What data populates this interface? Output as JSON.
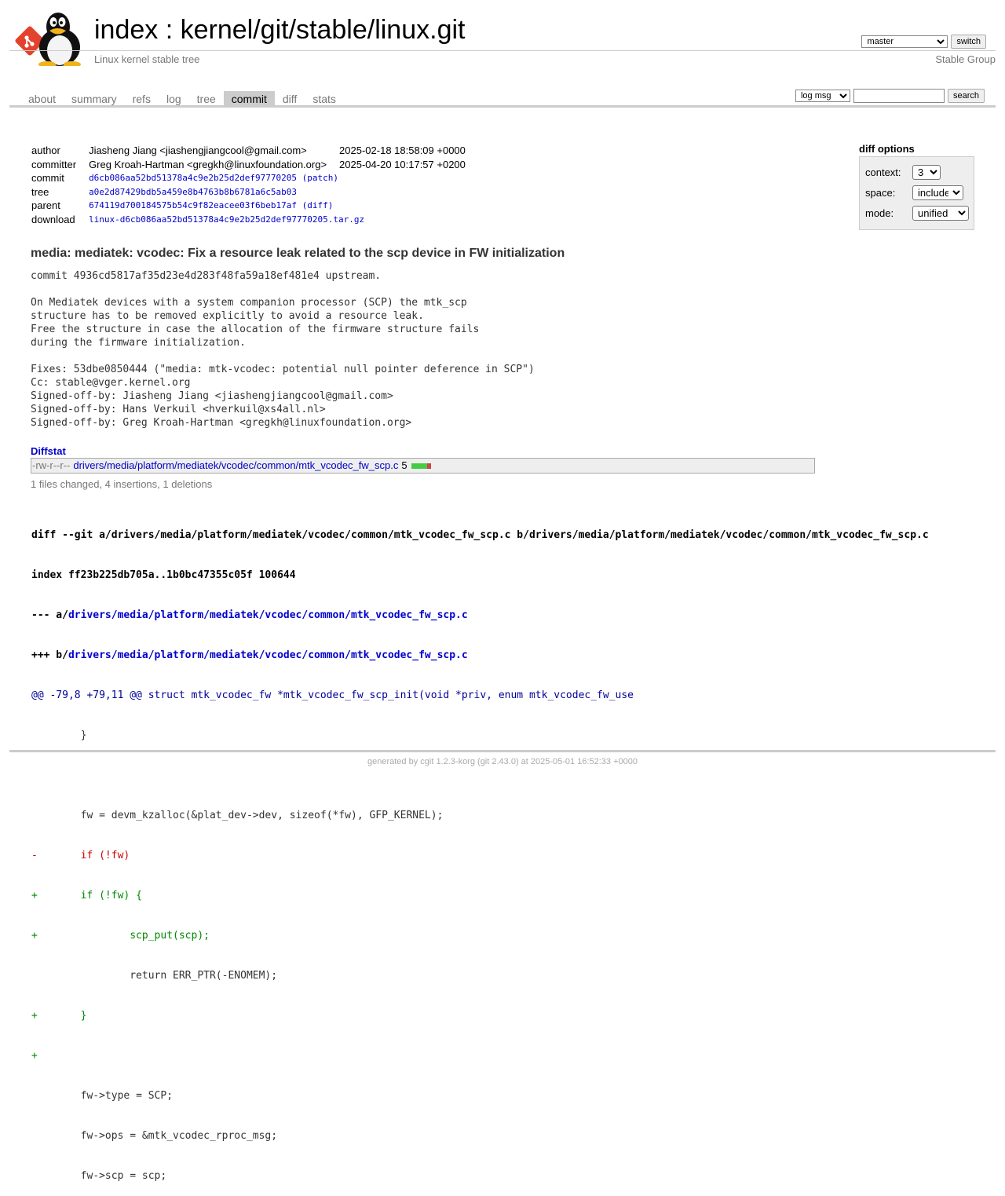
{
  "header": {
    "title_index": "index",
    "title_separator": " : ",
    "title_repo": "kernel/git/stable/linux.git",
    "subtitle": "Linux kernel stable tree",
    "owner": "Stable Group",
    "branch_selected": "master",
    "switch_label": "switch"
  },
  "tabs": [
    {
      "label": "about",
      "active": false
    },
    {
      "label": "summary",
      "active": false
    },
    {
      "label": "refs",
      "active": false
    },
    {
      "label": "log",
      "active": false
    },
    {
      "label": "tree",
      "active": false
    },
    {
      "label": "commit",
      "active": true
    },
    {
      "label": "diff",
      "active": false
    },
    {
      "label": "stats",
      "active": false
    }
  ],
  "search": {
    "mode_selected": "log msg",
    "query": "",
    "button_label": "search"
  },
  "commit_info": {
    "author_label": "author",
    "author": "Jiasheng Jiang <jiashengjiangcool@gmail.com>",
    "author_date": "2025-02-18 18:58:09 +0000",
    "committer_label": "committer",
    "committer": "Greg Kroah-Hartman <gregkh@linuxfoundation.org>",
    "committer_date": "2025-04-20 10:17:57 +0200",
    "commit_label": "commit",
    "commit": "d6cb086aa52bd51378a4c9e2b25d2def97770205",
    "patch_link": "patch",
    "tree_label": "tree",
    "tree": "a0e2d87429bdb5a459e8b4763b8b6781a6c5ab03",
    "parent_label": "parent",
    "parent": "674119d700184575b54c9f82eacee03f6beb17af",
    "diff_link": "diff",
    "download_label": "download",
    "download": "linux-d6cb086aa52bd51378a4c9e2b25d2def97770205.tar.gz"
  },
  "diff_options": {
    "title": "diff options",
    "context_label": "context:",
    "context_value": "3",
    "space_label": "space:",
    "space_value": "include",
    "mode_label": "mode:",
    "mode_value": "unified"
  },
  "commit_subject": "media: mediatek: vcodec: Fix a resource leak related to the scp device in FW initialization",
  "commit_message": "commit 4936cd5817af35d23e4d283f48fa59a18ef481e4 upstream.\n\nOn Mediatek devices with a system companion processor (SCP) the mtk_scp\nstructure has to be removed explicitly to avoid a resource leak.\nFree the structure in case the allocation of the firmware structure fails\nduring the firmware initialization.\n\nFixes: 53dbe0850444 (\"media: mtk-vcodec: potential null pointer deference in SCP\")\nCc: stable@vger.kernel.org\nSigned-off-by: Jiasheng Jiang <jiashengjiangcool@gmail.com>\nSigned-off-by: Hans Verkuil <hverkuil@xs4all.nl>\nSigned-off-by: Greg Kroah-Hartman <gregkh@linuxfoundation.org>",
  "diffstat": {
    "header": "Diffstat",
    "mode": "-rw-r--r--",
    "file": "drivers/media/platform/mediatek/vcodec/common/mtk_vcodec_fw_scp.c",
    "count": "5",
    "insertions": 4,
    "deletions": 1,
    "summary": "1 files changed, 4 insertions, 1 deletions"
  },
  "diff": {
    "git_line": "diff --git a/drivers/media/platform/mediatek/vcodec/common/mtk_vcodec_fw_scp.c b/drivers/media/platform/mediatek/vcodec/common/mtk_vcodec_fw_scp.c",
    "index_line": "index ff23b225db705a..1b0bc47355c05f 100644",
    "minus_prefix": "--- a/",
    "minus_path": "drivers/media/platform/mediatek/vcodec/common/mtk_vcodec_fw_scp.c",
    "plus_prefix": "+++ b/",
    "plus_path": "drivers/media/platform/mediatek/vcodec/common/mtk_vcodec_fw_scp.c",
    "hunk": "@@ -79,8 +79,11 @@ struct mtk_vcodec_fw *mtk_vcodec_fw_scp_init(void *priv, enum mtk_vcodec_fw_use",
    "lines": [
      {
        "type": "ctx",
        "text": " \t}"
      },
      {
        "type": "ctx",
        "text": " "
      },
      {
        "type": "ctx",
        "text": " \tfw = devm_kzalloc(&plat_dev->dev, sizeof(*fw), GFP_KERNEL);"
      },
      {
        "type": "del",
        "text": "-\tif (!fw)"
      },
      {
        "type": "add",
        "text": "+\tif (!fw) {"
      },
      {
        "type": "add",
        "text": "+\t\tscp_put(scp);"
      },
      {
        "type": "ctx",
        "text": " \t\treturn ERR_PTR(-ENOMEM);"
      },
      {
        "type": "add",
        "text": "+\t}"
      },
      {
        "type": "add",
        "text": "+"
      },
      {
        "type": "ctx",
        "text": " \tfw->type = SCP;"
      },
      {
        "type": "ctx",
        "text": " \tfw->ops = &mtk_vcodec_rproc_msg;"
      },
      {
        "type": "ctx",
        "text": " \tfw->scp = scp;"
      }
    ]
  },
  "footer": {
    "prefix": "generated by ",
    "cgit": "cgit 1.2.3-korg",
    "git": " (git 2.43.0)",
    "suffix": " at 2025-05-01 16:52:33 +0000"
  }
}
